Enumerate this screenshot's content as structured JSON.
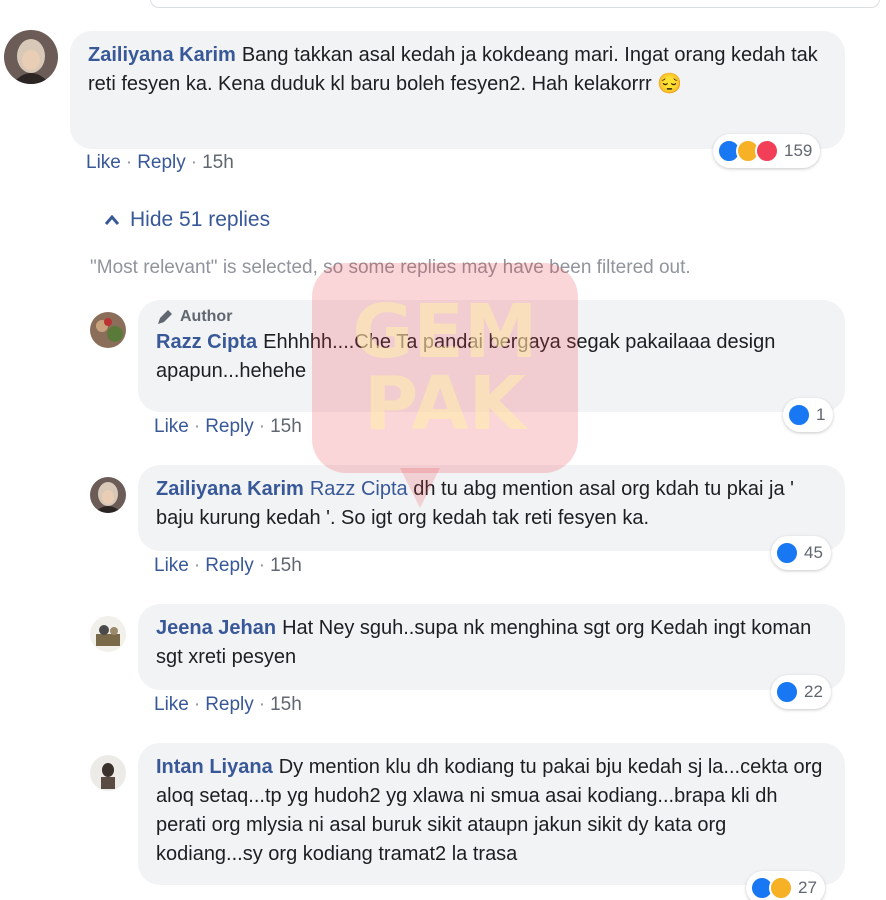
{
  "main_comment": {
    "name": "Zailiyana Karim",
    "text": "Bang takkan asal kedah ja kokdeang mari. Ingat orang kedah tak reti fesyen ka. Kena duduk kl baru boleh fesyen2. Hah kelakorrr",
    "emoji": "😔",
    "reaction_count": "159",
    "actions": {
      "like": "Like",
      "reply": "Reply",
      "time": "15h",
      "sep": "·"
    }
  },
  "replies_toggle": {
    "label": "Hide 51 replies",
    "icon": "chevron-up-icon"
  },
  "filter_note": "\"Most relevant\" is selected, so some replies may have been filtered out.",
  "watermark": {
    "line1": "GEM",
    "line2": "PAK"
  },
  "replies": [
    {
      "badge": "Author",
      "name": "Razz Cipta",
      "text": "Ehhhhh....Che Ta pandai bergaya segak pakailaaa design apapun...hehehe",
      "reaction_count": "1",
      "actions": {
        "like": "Like",
        "reply": "Reply",
        "time": "15h",
        "sep": "·"
      }
    },
    {
      "name": "Zailiyana Karim",
      "tag": "Razz Cipta",
      "text": "dh tu abg mention asal org kdah tu pkai ja ' baju kurung kedah '. So igt org kedah tak reti fesyen ka.",
      "reaction_count": "45",
      "actions": {
        "like": "Like",
        "reply": "Reply",
        "time": "15h",
        "sep": "·"
      }
    },
    {
      "name": "Jeena Jehan",
      "text": "Hat Ney sguh..supa nk menghina sgt org Kedah ingt koman sgt xreti pesyen",
      "reaction_count": "22",
      "actions": {
        "like": "Like",
        "reply": "Reply",
        "time": "15h",
        "sep": "·"
      }
    },
    {
      "name": "Intan Liyana",
      "text": "Dy mention klu dh kodiang tu pakai bju kedah sj la...cekta org aloq setaq...tp yg hudoh2 yg xlawa ni smua asai kodiang...brapa kli dh perati org mlysia ni asal buruk sikit ataupn jakun sikit dy kata org kodiang...sy org kodiang tramat2 la trasa",
      "reaction_count": "27"
    }
  ],
  "colors": {
    "link": "#385898",
    "bubble": "#f2f3f5",
    "muted": "#606770",
    "like": "#1877f2",
    "haha": "#f7b125",
    "love": "#f33e58"
  }
}
